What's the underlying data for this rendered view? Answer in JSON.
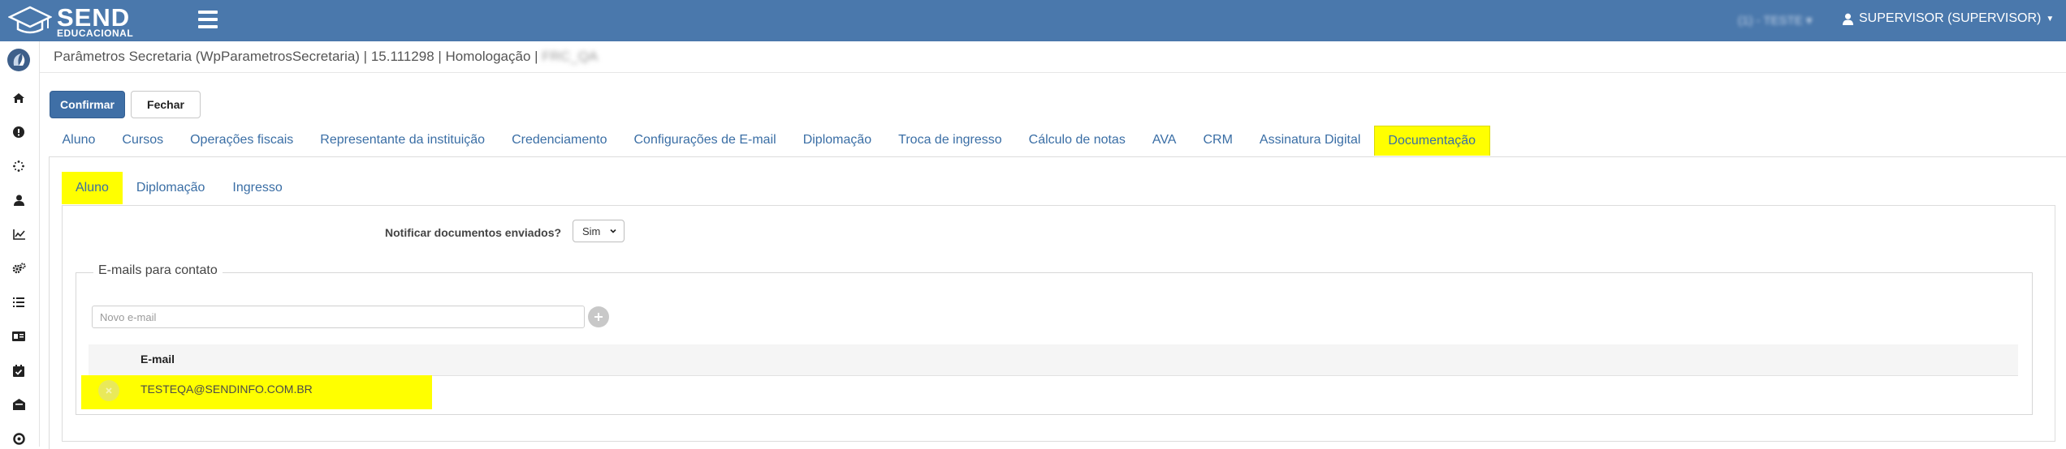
{
  "brand": {
    "name": "SEND",
    "subtitle": "EDUCACIONAL"
  },
  "navbar": {
    "tenant_label": "(1) - TESTE",
    "user_label": "SUPERVISOR (SUPERVISOR)"
  },
  "sidebar": {
    "icons": [
      "home-icon",
      "info-icon",
      "spinner-icon",
      "user-icon",
      "chart-icon",
      "gears-icon",
      "list-icon",
      "id-card-icon",
      "calendar-check-icon",
      "inbox-icon",
      "support-icon"
    ]
  },
  "page": {
    "title": "Parâmetros Secretaria (WpParametrosSecretaria) | 15.111298 | Homologação |",
    "title_suffix": "FRC_QA"
  },
  "toolbar": {
    "confirm_label": "Confirmar",
    "close_label": "Fechar"
  },
  "tabs": [
    {
      "label": "Aluno"
    },
    {
      "label": "Cursos"
    },
    {
      "label": "Operações fiscais"
    },
    {
      "label": "Representante da instituição"
    },
    {
      "label": "Credenciamento"
    },
    {
      "label": "Configurações de E-mail"
    },
    {
      "label": "Diplomação"
    },
    {
      "label": "Troca de ingresso"
    },
    {
      "label": "Cálculo de notas"
    },
    {
      "label": "AVA"
    },
    {
      "label": "CRM"
    },
    {
      "label": "Assinatura Digital"
    },
    {
      "label": "Documentação"
    }
  ],
  "subtabs": [
    {
      "label": "Aluno"
    },
    {
      "label": "Diplomação"
    },
    {
      "label": "Ingresso"
    }
  ],
  "form": {
    "notify_label": "Notificar documentos enviados?",
    "notify_value": "Sim",
    "emails_legend": "E-mails para contato",
    "new_email_placeholder": "Novo e-mail",
    "table_header_email": "E-mail",
    "emails": [
      "TESTEQA@SENDINFO.COM.BR"
    ]
  },
  "colors": {
    "navbar": "#4a78ac",
    "link": "#3a6ea5",
    "highlight": "#ffff00",
    "primary_button": "#3f6fa6"
  }
}
